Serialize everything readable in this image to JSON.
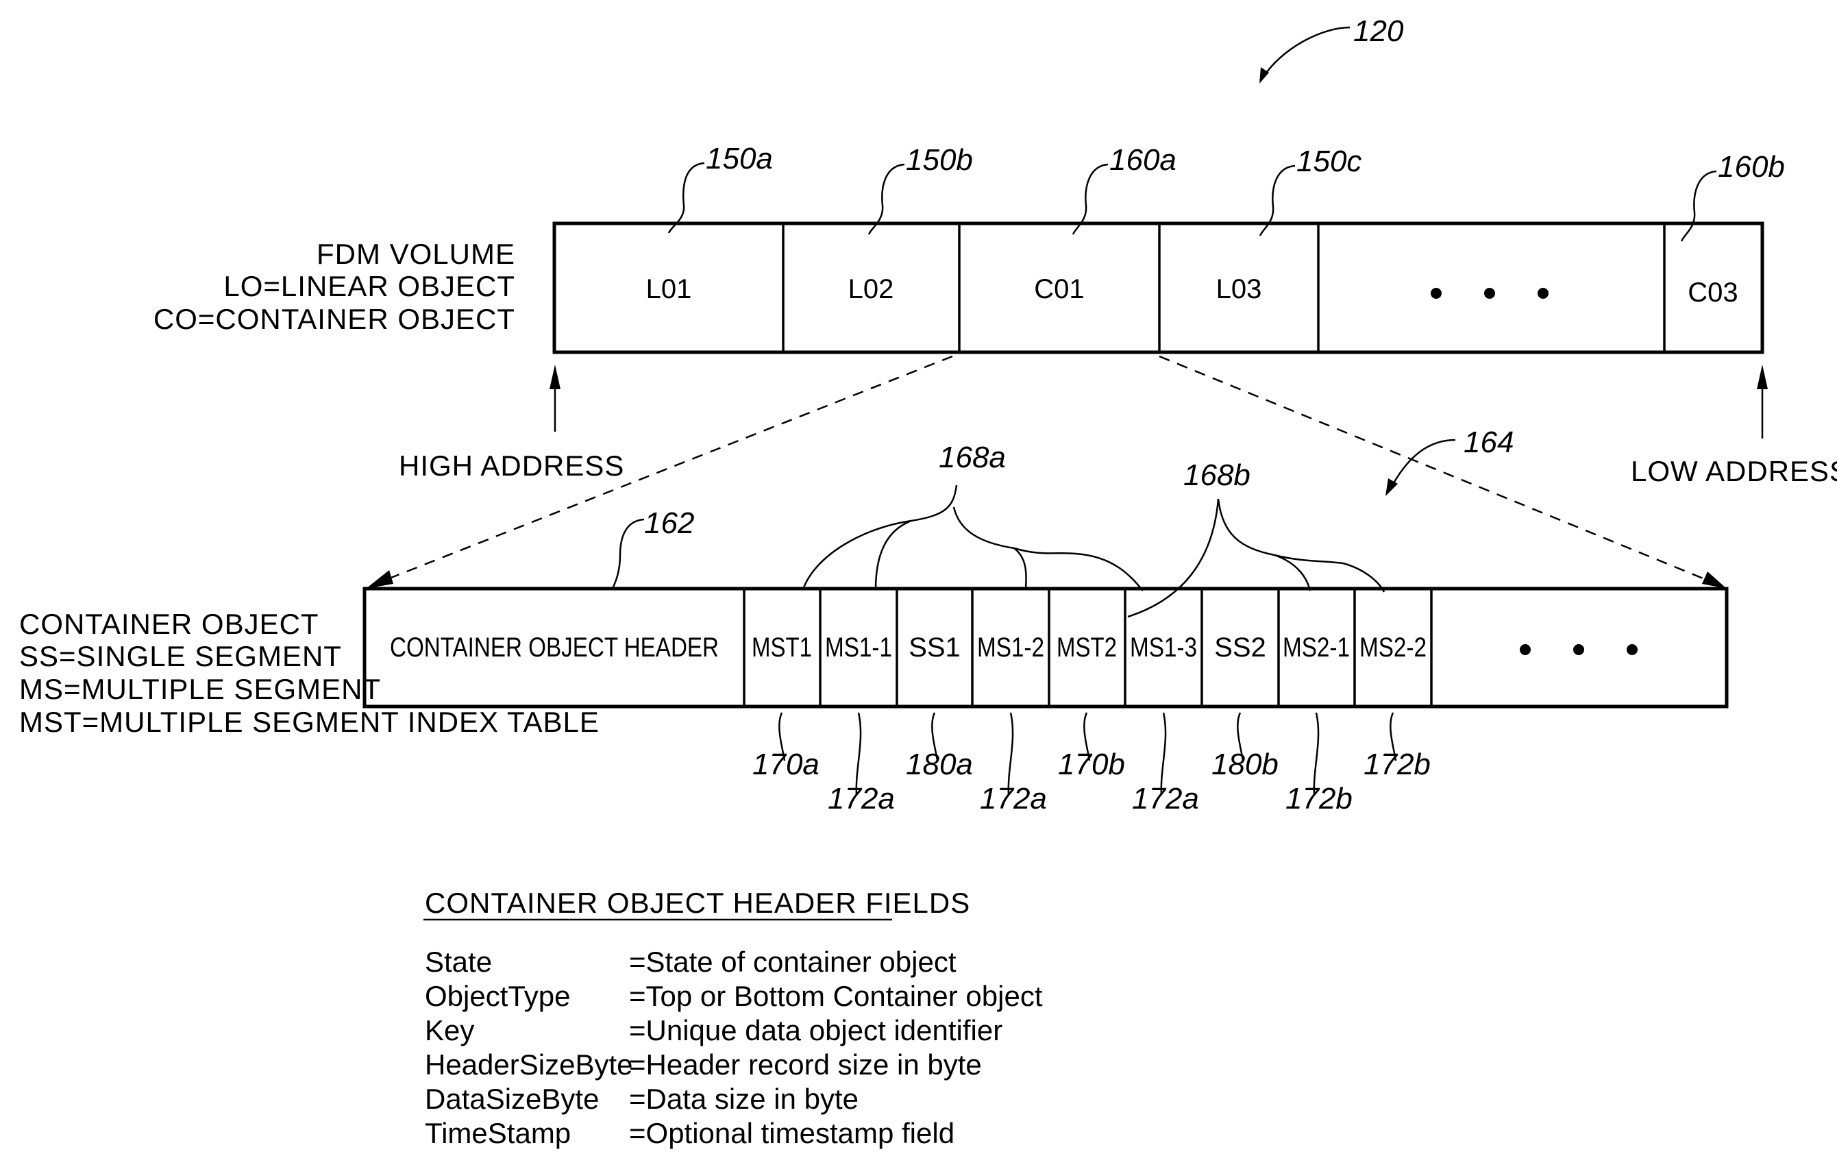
{
  "figure": {
    "ref_overall": "120",
    "volume": {
      "legend": [
        "FDM VOLUME",
        "LO=LINEAR OBJECT",
        "CO=CONTAINER OBJECT"
      ],
      "cells": [
        {
          "label": "L01",
          "ref": "150a"
        },
        {
          "label": "L02",
          "ref": "150b"
        },
        {
          "label": "C01",
          "ref": "160a"
        },
        {
          "label": "L03",
          "ref": "150c"
        },
        {
          "label": "• • •",
          "ref": ""
        },
        {
          "label": "C03",
          "ref": "160b"
        }
      ],
      "high_address": "HIGH ADDRESS",
      "low_address": "LOW ADDRESS"
    },
    "container": {
      "ref_expansion": "164",
      "ref_header": "162",
      "legend": [
        "CONTAINER OBJECT",
        "SS=SINGLE SEGMENT",
        "MS=MULTIPLE SEGMENT",
        "MST=MULTIPLE SEGMENT INDEX TABLE"
      ],
      "cells": [
        {
          "label": "CONTAINER OBJECT HEADER",
          "ref": ""
        },
        {
          "label": "MST1",
          "ref": "170a"
        },
        {
          "label": "MS1-1",
          "ref": "172a"
        },
        {
          "label": "SS1",
          "ref": "180a"
        },
        {
          "label": "MS1-2",
          "ref": "172a"
        },
        {
          "label": "MST2",
          "ref": "170b"
        },
        {
          "label": "MS1-3",
          "ref": "172a"
        },
        {
          "label": "SS2",
          "ref": "180b"
        },
        {
          "label": "MS2-1",
          "ref": "172b"
        },
        {
          "label": "MS2-2",
          "ref": "172b"
        },
        {
          "label": "• • •",
          "ref": ""
        }
      ],
      "group_refs": [
        "168a",
        "168b"
      ]
    },
    "header_fields": {
      "title": "CONTAINER OBJECT HEADER FIELDS",
      "rows": [
        {
          "field": "State",
          "desc": "=State of container object"
        },
        {
          "field": "ObjectType",
          "desc": "=Top or Bottom Container object"
        },
        {
          "field": "Key",
          "desc": "=Unique data object identifier"
        },
        {
          "field": "HeaderSizeByte",
          "desc": "=Header record size in byte"
        },
        {
          "field": "DataSizeByte",
          "desc": "=Data size in byte"
        },
        {
          "field": "TimeStamp",
          "desc": "=Optional timestamp field"
        }
      ]
    }
  }
}
